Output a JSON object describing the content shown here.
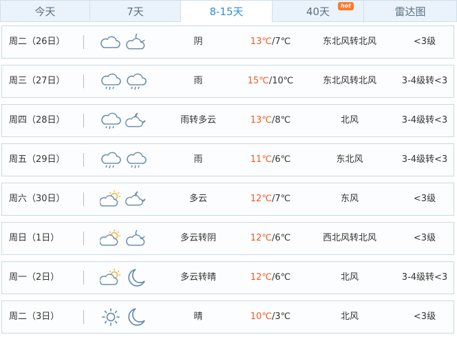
{
  "tabs": [
    {
      "label": "今天"
    },
    {
      "label": "7天"
    },
    {
      "label": "8-15天"
    },
    {
      "label": "40天",
      "badge": "hot"
    },
    {
      "label": "雷达图"
    }
  ],
  "active_tab": "8-15天",
  "colors": {
    "accent": "#2f8fd8",
    "high_temp": "#f05b1e",
    "icon_stroke": "#6b8fb0",
    "sun": "#f0b53a"
  },
  "days": [
    {
      "day": "周二（26日）",
      "icon_day": "cloudy-icon",
      "icon_night": "cloudy-night-icon",
      "condition": "阴",
      "high": "13℃",
      "low": "/7℃",
      "wind": "东北风转北风",
      "level": "<3级"
    },
    {
      "day": "周三（27日）",
      "icon_day": "rain-icon",
      "icon_night": "rain-icon",
      "condition": "雨",
      "high": "15℃",
      "low": "/10℃",
      "wind": "东北风转北风",
      "level": "3-4级转<3"
    },
    {
      "day": "周四（28日）",
      "icon_day": "rain-icon",
      "icon_night": "partly-cloudy-night-icon",
      "condition": "雨转多云",
      "high": "13℃",
      "low": "/8℃",
      "wind": "北风",
      "level": "3-4级转<3"
    },
    {
      "day": "周五（29日）",
      "icon_day": "rain-icon",
      "icon_night": "rain-icon",
      "condition": "雨",
      "high": "11℃",
      "low": "/6℃",
      "wind": "东北风",
      "level": "3-4级转<3"
    },
    {
      "day": "周六（30日）",
      "icon_day": "partly-cloudy-icon",
      "icon_night": "partly-cloudy-night-icon",
      "condition": "多云",
      "high": "12℃",
      "low": "/7℃",
      "wind": "东风",
      "level": "<3级"
    },
    {
      "day": "周日（1日）",
      "icon_day": "partly-cloudy-icon",
      "icon_night": "cloudy-night-icon",
      "condition": "多云转阴",
      "high": "12℃",
      "low": "/6℃",
      "wind": "西北风转北风",
      "level": "<3级"
    },
    {
      "day": "周一（2日）",
      "icon_day": "partly-cloudy-icon",
      "icon_night": "clear-night-icon",
      "condition": "多云转晴",
      "high": "12℃",
      "low": "/6℃",
      "wind": "北风",
      "level": "3-4级转<3"
    },
    {
      "day": "周二（3日）",
      "icon_day": "sunny-icon",
      "icon_night": "clear-night-icon",
      "condition": "晴",
      "high": "10℃",
      "low": "/3℃",
      "wind": "北风",
      "level": "<3级"
    }
  ]
}
